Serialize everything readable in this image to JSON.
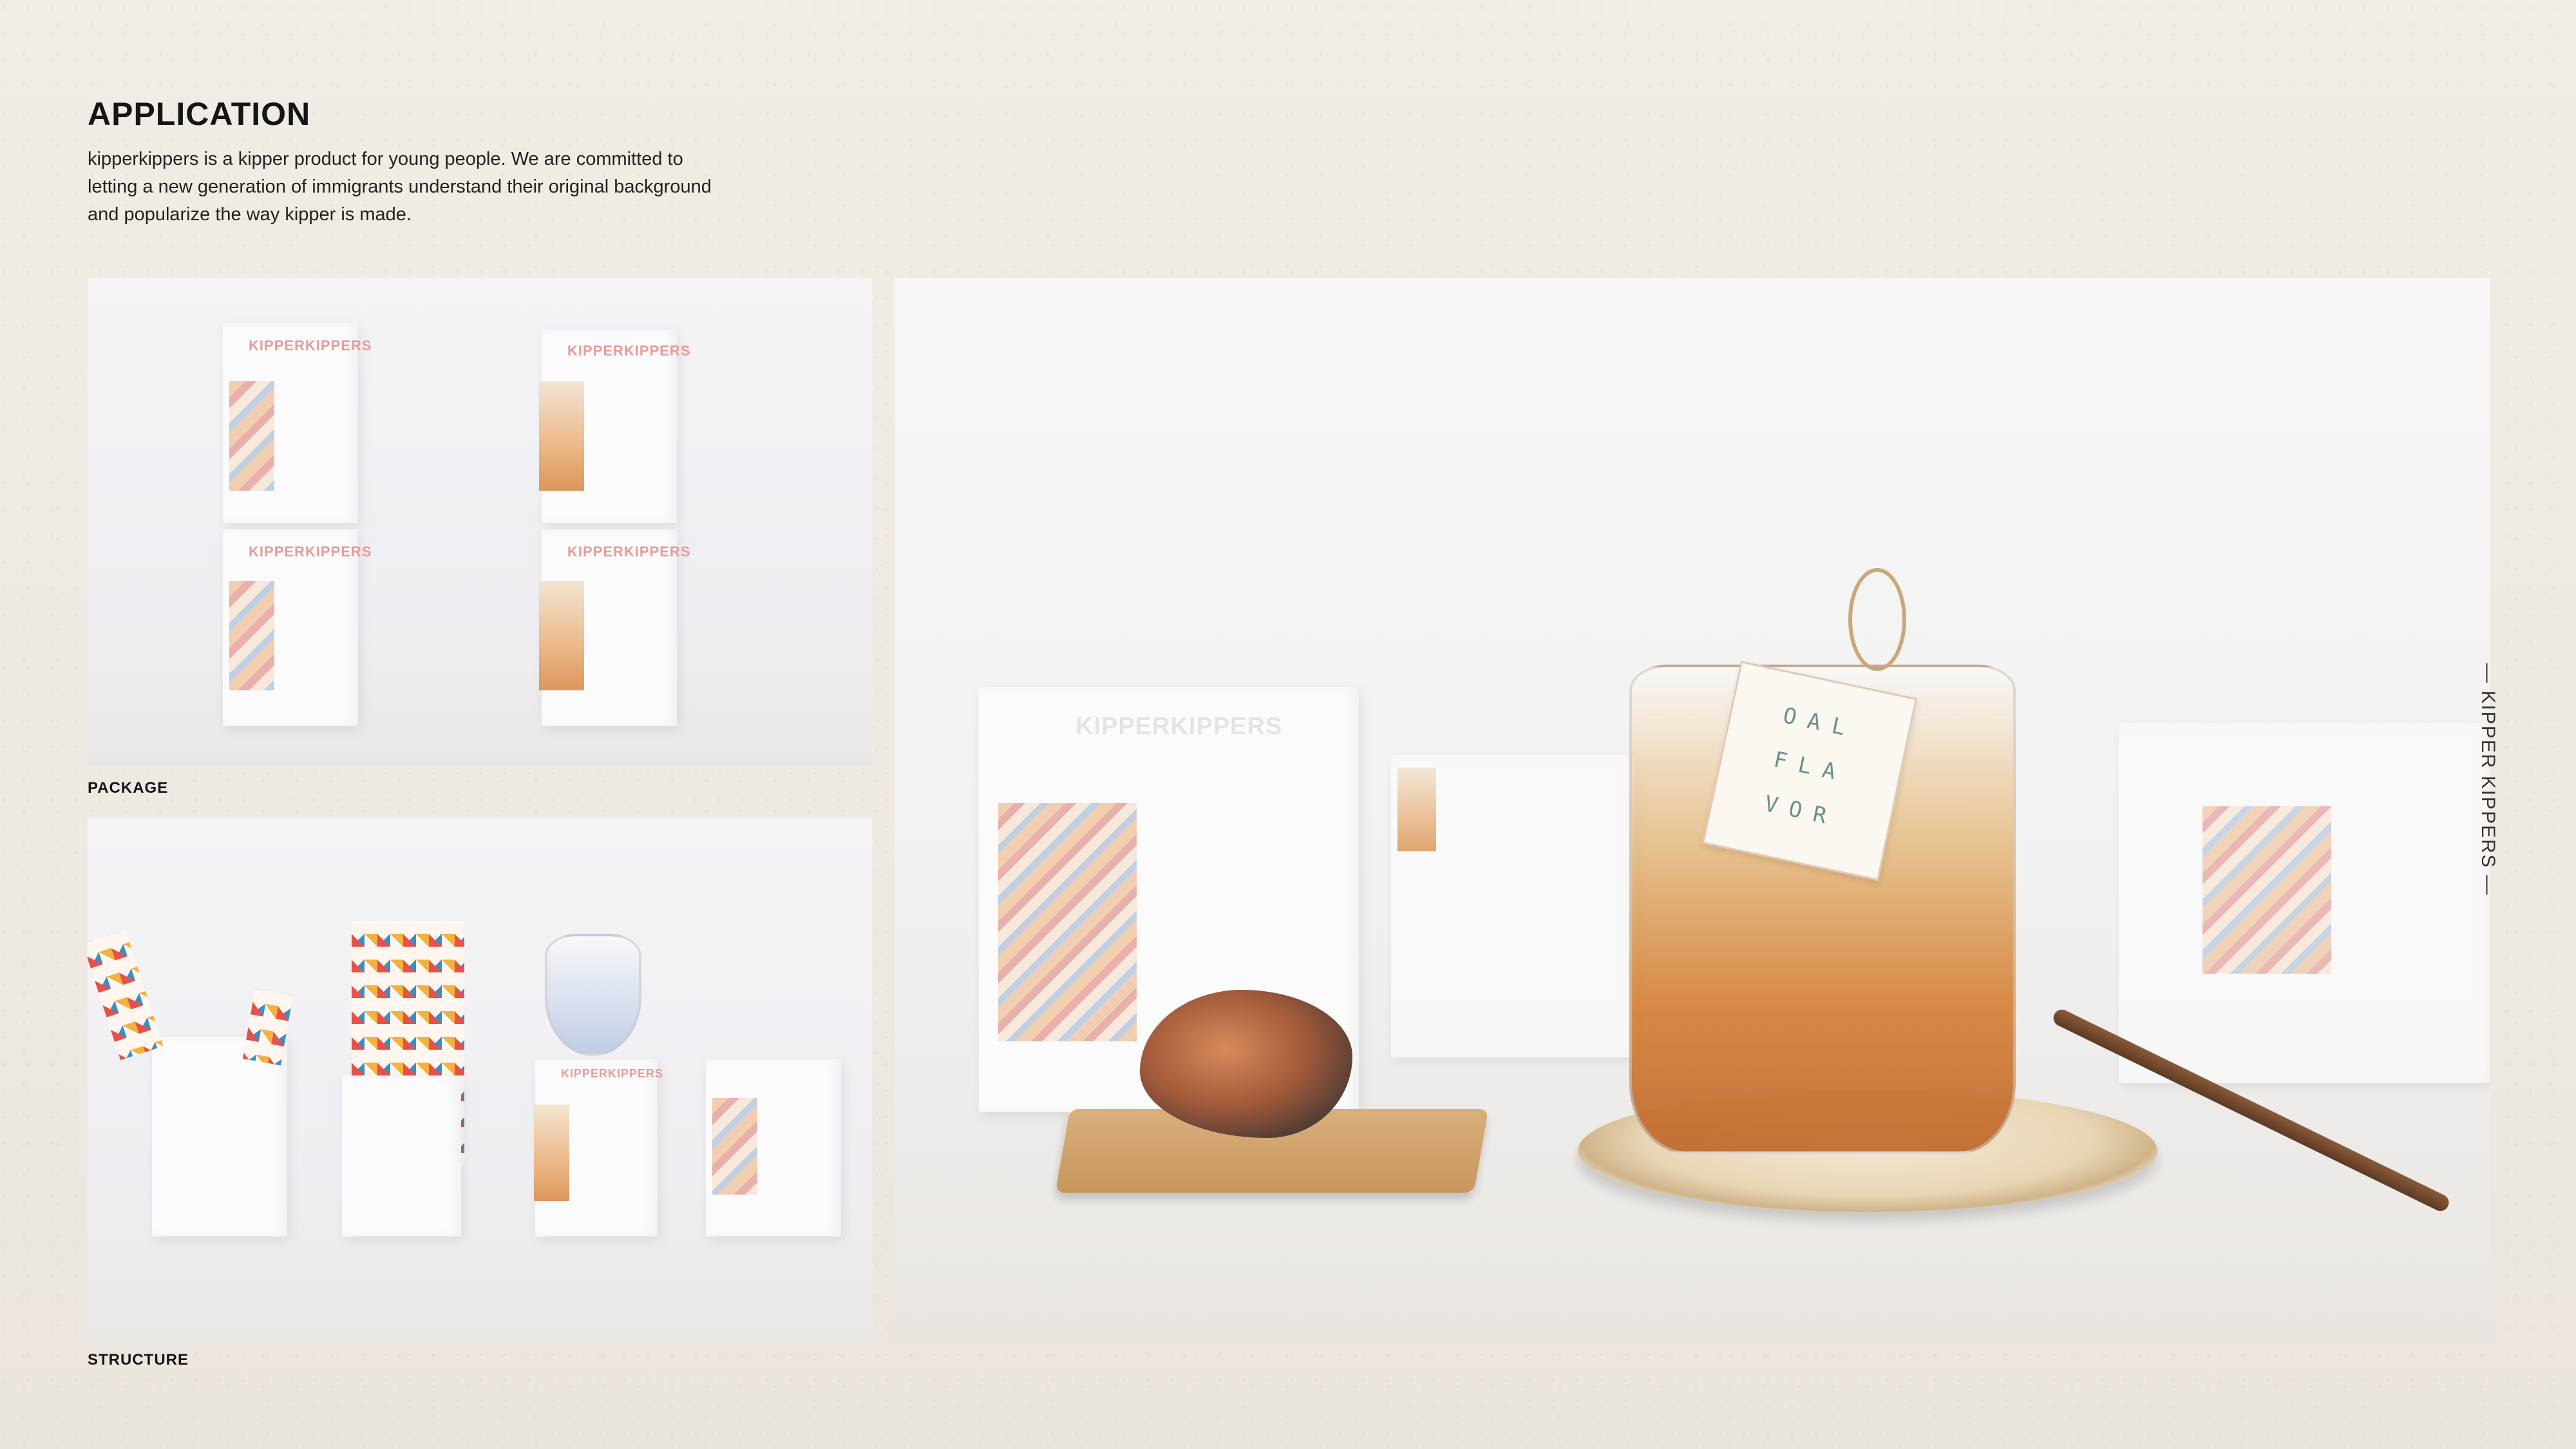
{
  "header": {
    "title": "APPLICATION",
    "description": "kipperkippers is a kipper product for young people. We are committed to letting a new generation of immigrants understand their original background and popularize the way kipper is made."
  },
  "captions": {
    "package": "PACKAGE",
    "structure": "STRUCTURE"
  },
  "side_label": "— KIPPER KIPPERS —",
  "brand": {
    "logo": "KIPPERKIPPERS"
  },
  "tag": {
    "row1": "OAL",
    "row2": "FLA",
    "row3": "VOR"
  },
  "colors": {
    "background": "#efebe3",
    "text": "#151515",
    "accent_pink": "#e99a9a"
  }
}
